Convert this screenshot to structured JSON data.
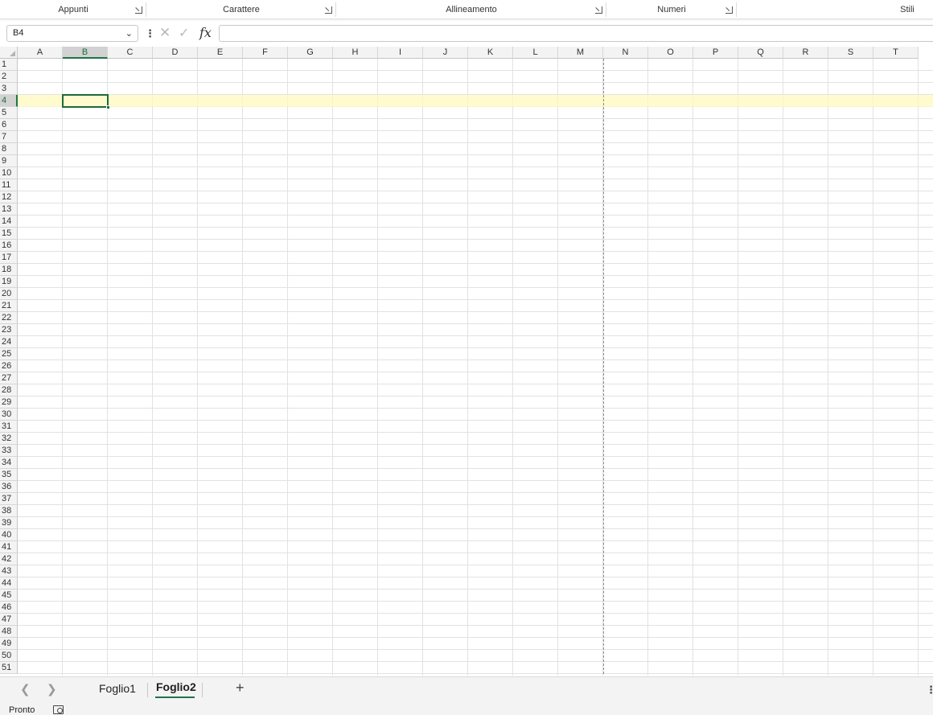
{
  "ribbon": {
    "groups": [
      {
        "label": "Appunti"
      },
      {
        "label": "Carattere"
      },
      {
        "label": "Allineamento"
      },
      {
        "label": "Numeri"
      },
      {
        "label": "Stili"
      }
    ]
  },
  "formula_bar": {
    "name_box": "B4",
    "fx_label": "fx",
    "formula_value": ""
  },
  "grid": {
    "columns": [
      "A",
      "B",
      "C",
      "D",
      "E",
      "F",
      "G",
      "H",
      "I",
      "J",
      "K",
      "L",
      "M",
      "N",
      "O",
      "P",
      "Q",
      "R",
      "S",
      "T"
    ],
    "rows": [
      "1",
      "2",
      "3",
      "4",
      "5",
      "6",
      "7",
      "8",
      "9",
      "10",
      "11",
      "12",
      "13",
      "14",
      "15",
      "16",
      "17",
      "18",
      "19",
      "20",
      "21",
      "22",
      "23",
      "24",
      "25",
      "26",
      "27",
      "28",
      "29",
      "30",
      "31",
      "32",
      "33",
      "34",
      "35",
      "36",
      "37",
      "38",
      "39",
      "40",
      "41",
      "42",
      "43",
      "44",
      "45",
      "46",
      "47",
      "48",
      "49",
      "50",
      "51"
    ],
    "active_cell": "B4",
    "selected_column": "B",
    "selected_row": "4"
  },
  "sheets": {
    "tabs": [
      {
        "label": "Foglio1",
        "active": false
      },
      {
        "label": "Foglio2",
        "active": true
      }
    ]
  },
  "status_bar": {
    "status": "Pronto"
  }
}
